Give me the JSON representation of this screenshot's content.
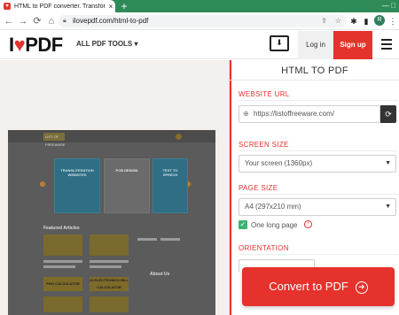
{
  "browser": {
    "tab_title": "HTML to PDF converter. Transfor",
    "tab_close": "×",
    "new_tab": "+",
    "window_controls": "— ⃞",
    "url": "ilovepdf.com/html-to-pdf",
    "profile_initial": "R"
  },
  "header": {
    "logo_i": "I",
    "logo_pdf": "PDF",
    "all_tools": "ALL PDF TOOLS ▾",
    "login": "Log in",
    "signup": "Sign up"
  },
  "panel": {
    "title": "HTML TO PDF",
    "website_url_label": "WEBSITE URL",
    "url_value": "https://listoffreeware.com/",
    "screen_size_label": "SCREEN SIZE",
    "screen_size_value": "Your screen (1360px)",
    "page_size_label": "PAGE SIZE",
    "page_size_value": "A4 (297x210 mm)",
    "one_long_page": "One long page",
    "one_long_page_checked": true,
    "orientation_label": "ORIENTATION",
    "convert_button": "Convert to PDF"
  },
  "preview": {
    "site_logo": "LIST OF FREEWARE",
    "featured_articles": "Featured Articles",
    "about_us": "About Us",
    "card1": "TRANSLITERATION WEBSITES",
    "card2": "PCB DESIGN",
    "card3": "TEXT TO SPEECH",
    "block1": "PNG CALCULATOR",
    "block2": "AI ELECTRONICS BILL CALCULATOR"
  },
  "colors": {
    "brand_red": "#e5322d",
    "browser_green": "#2e8b57",
    "checkbox_green": "#3cb371"
  }
}
